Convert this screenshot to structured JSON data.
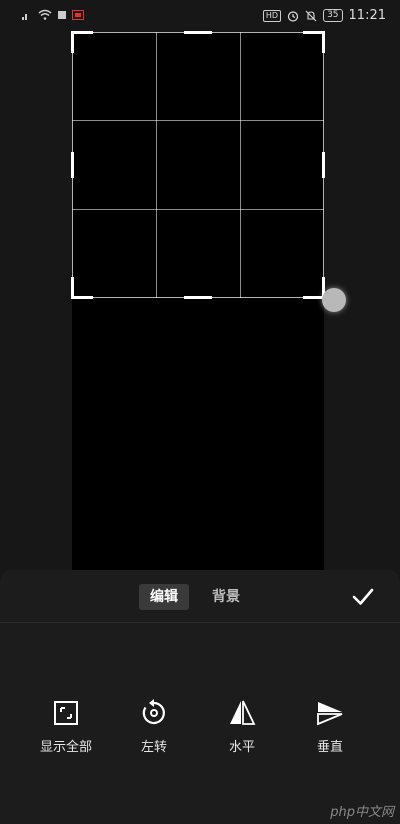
{
  "status_bar": {
    "signal_icon": "signal-icon",
    "wifi_icon": "wifi-icon",
    "hd_badge": "HD",
    "battery_level": "35",
    "time": "11:21"
  },
  "tabs": [
    {
      "label": "编辑",
      "active": true
    },
    {
      "label": "背景",
      "active": false
    }
  ],
  "tools": [
    {
      "label": "显示全部",
      "icon": "show-all-icon"
    },
    {
      "label": "左转",
      "icon": "rotate-left-icon"
    },
    {
      "label": "水平",
      "icon": "flip-horizontal-icon"
    },
    {
      "label": "垂直",
      "icon": "flip-vertical-icon"
    }
  ],
  "watermark": "php中文网",
  "colors": {
    "background": "#171717",
    "panel": "#1c1c1c",
    "active_tab": "#3a3a3a",
    "canvas": "#000000"
  }
}
